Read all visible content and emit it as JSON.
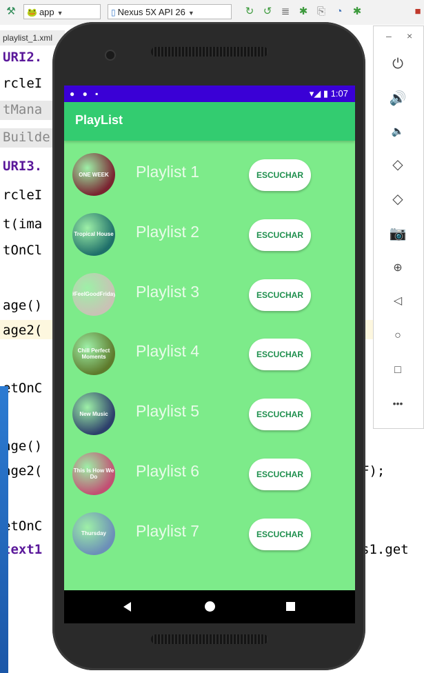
{
  "toolbar": {
    "run_config": "app",
    "device": "Nexus 5X API 26"
  },
  "editor": {
    "file_tab": "playlist_1.xml",
    "lines": [
      {
        "text": "URI2.",
        "color": "#5a189a",
        "bold": true
      },
      {
        "text": "rcleI",
        "color": "#000000",
        "bold": false
      },
      {
        "text": "tMana",
        "color": "#888888",
        "bold": false
      },
      {
        "text": "Builde",
        "color": "#888888",
        "bold": false
      },
      {
        "text": "URI3.",
        "color": "#5a189a",
        "bold": true
      },
      {
        "text": "rcleI",
        "color": "#000000",
        "bold": false
      },
      {
        "text": "t(ima",
        "color": "#000000",
        "bold": false
      },
      {
        "text": "tOnCl",
        "color": "#000000",
        "bold": false
      },
      {
        "text": "age()",
        "color": "#000000",
        "bold": false
      },
      {
        "text": "age2(",
        "color": "#000000",
        "bold": false
      },
      {
        "text": "etOnC",
        "color": "#000000",
        "bold": false
      },
      {
        "text": "age()",
        "color": "#000000",
        "bold": false
      },
      {
        "text": "age2(",
        "color": "#000000",
        "bold": false
      },
      {
        "text": "etOnC",
        "color": "#000000",
        "bold": false
      },
      {
        "text": "text1",
        "color": "#5a189a",
        "bold": true
      }
    ],
    "right_fragments": {
      "f1": "F);",
      "f2": "s1.get"
    }
  },
  "emulator_panel": {
    "icons": [
      "power-icon",
      "volume-up-icon",
      "volume-down-icon",
      "rotate-left-icon",
      "rotate-right-icon",
      "camera-icon",
      "zoom-icon",
      "back-icon",
      "home-icon",
      "overview-icon",
      "more-icon"
    ]
  },
  "phone": {
    "status_time": "1:07",
    "app_title": "PlayList",
    "playlists": [
      {
        "label": "Playlist 1",
        "button": "ESCUCHAR",
        "cover_text": "ONE WEEK",
        "cover_color": "#7a2431"
      },
      {
        "label": "Playlist 2",
        "button": "ESCUCHAR",
        "cover_text": "Tropical House",
        "cover_color": "#1f6f6a"
      },
      {
        "label": "Playlist 3",
        "button": "ESCUCHAR",
        "cover_text": "#FeelGoodFriday",
        "cover_color": "#c9c2b5"
      },
      {
        "label": "Playlist 4",
        "button": "ESCUCHAR",
        "cover_text": "Chill Perfect Moments",
        "cover_color": "#5e7a2c"
      },
      {
        "label": "Playlist 5",
        "button": "ESCUCHAR",
        "cover_text": "New Music",
        "cover_color": "#2d3f6b"
      },
      {
        "label": "Playlist 6",
        "button": "ESCUCHAR",
        "cover_text": "This Is How We Do",
        "cover_color": "#c24f73"
      },
      {
        "label": "Playlist 7",
        "button": "ESCUCHAR",
        "cover_text": "Thursday",
        "cover_color": "#6c8fb8"
      }
    ]
  }
}
